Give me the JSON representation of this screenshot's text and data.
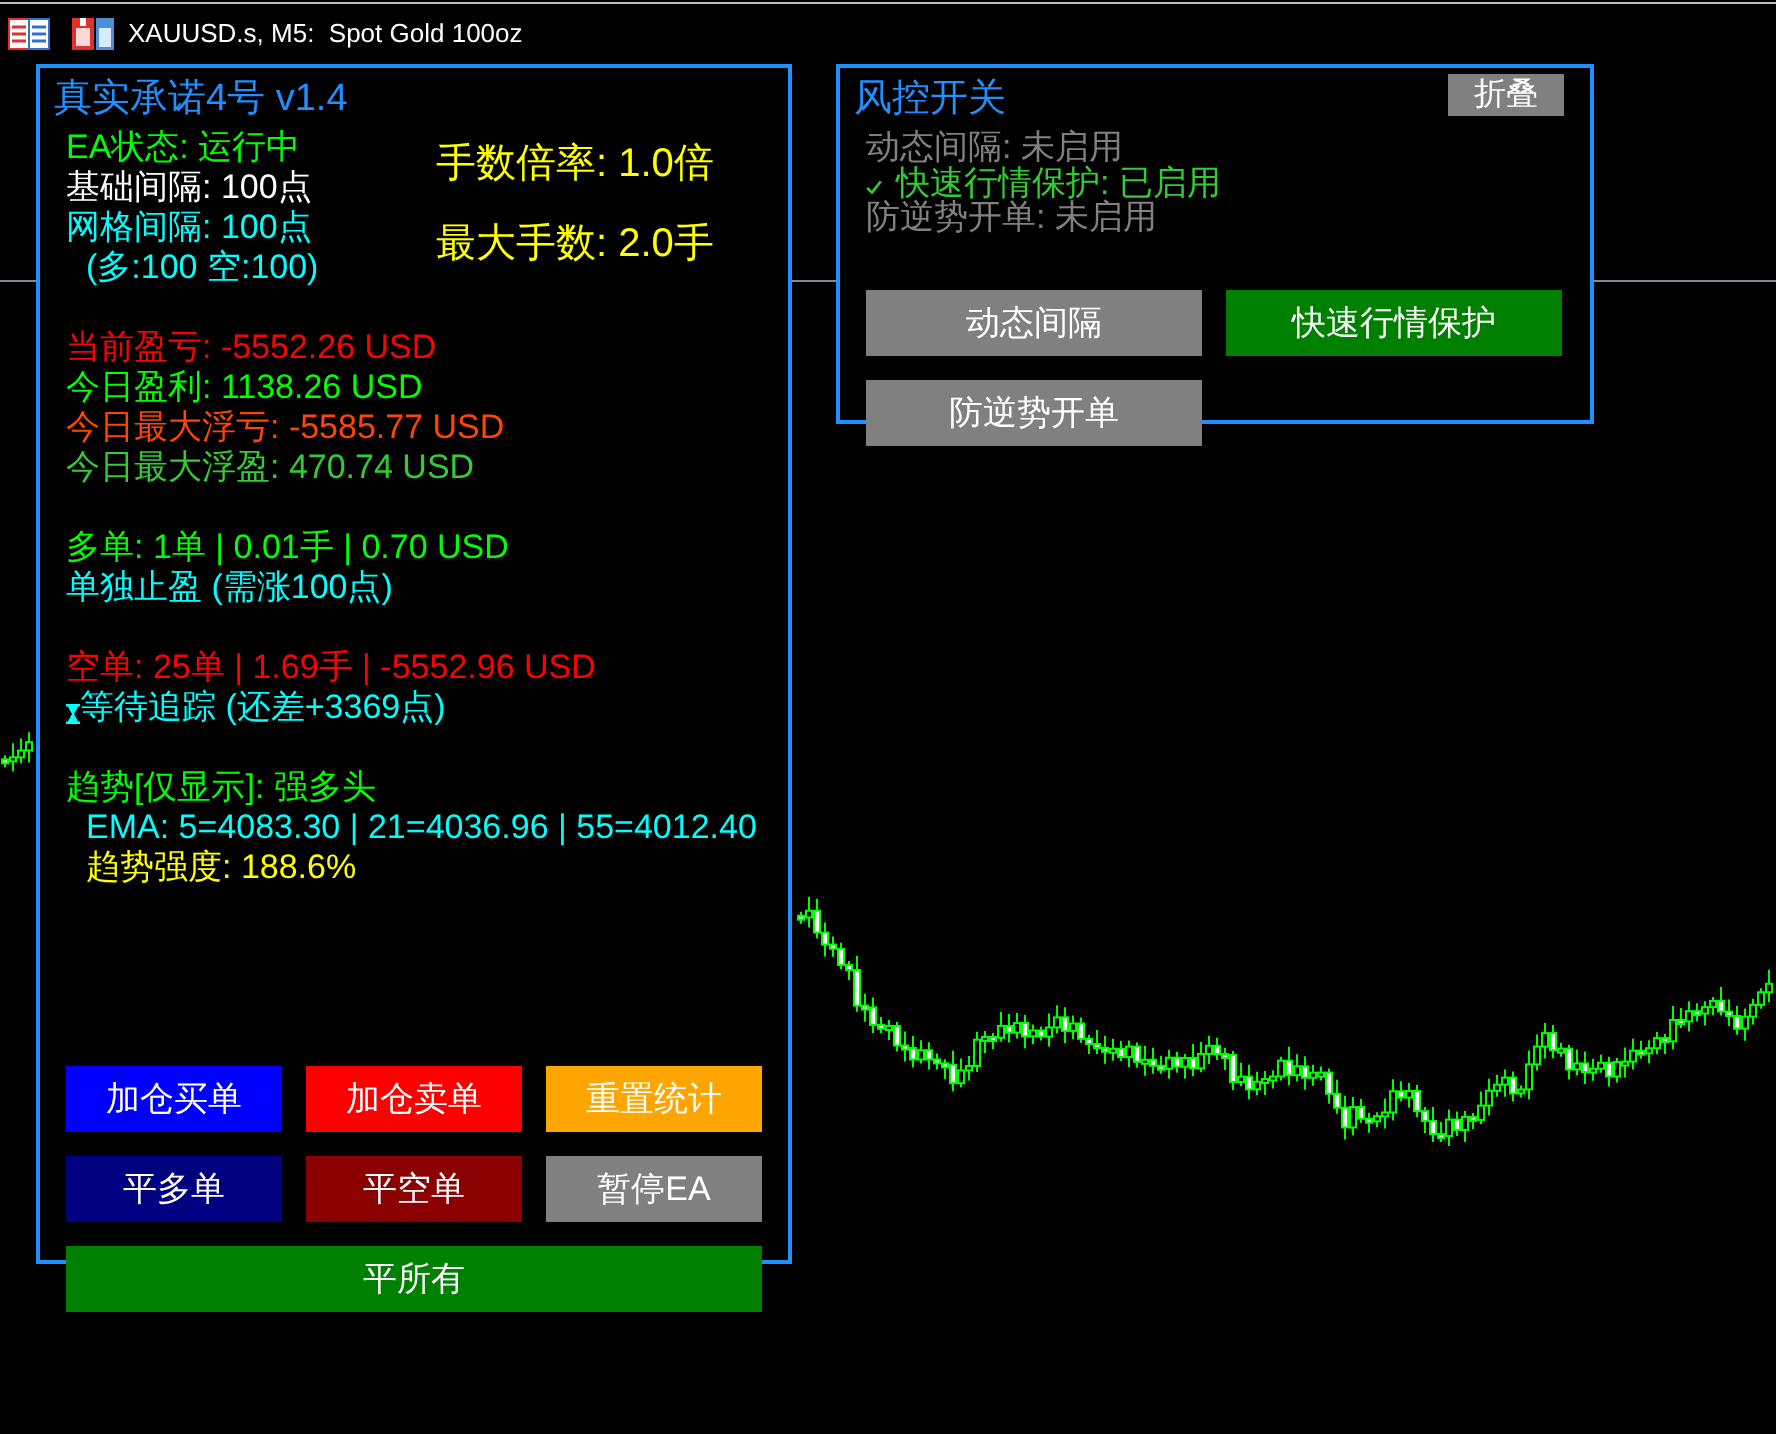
{
  "window": {
    "title": "XAUUSD.s, M5:  Spot Gold 100oz"
  },
  "main_panel": {
    "title": "真实承诺4号 v1.4",
    "lot_settings": [
      {
        "text": "手数倍率: 1.0倍"
      },
      {
        "text": "最大手数: 2.0手"
      }
    ],
    "groups": [
      {
        "lines": [
          {
            "kind": "text",
            "text": "EA状态: 运行中",
            "color": "#00ff00"
          },
          {
            "kind": "text",
            "text": "基础间隔: 100点",
            "color": "#ffffff"
          },
          {
            "kind": "text",
            "text": "网格间隔: 100点",
            "color": "#00ffff",
            "children": [
              {
                "kind": "text",
                "text": "(多:100 空:100)",
                "color": "#00ffff"
              }
            ]
          }
        ]
      },
      {
        "lines": [
          {
            "kind": "text",
            "text": "当前盈亏: -5552.26 USD",
            "color": "#ff0000"
          },
          {
            "kind": "text",
            "text": "今日盈利: 1138.26 USD",
            "color": "#00ff00"
          },
          {
            "kind": "text",
            "text": "今日最大浮亏: -5585.77 USD",
            "color": "#ff4500"
          },
          {
            "kind": "text",
            "text": "今日最大浮盈: 470.74 USD",
            "color": "#32cd32"
          }
        ]
      },
      {
        "lines": [
          {
            "kind": "text",
            "text": "多单: 1单 | 0.01手 | 0.70 USD",
            "color": "#00ff00"
          },
          {
            "kind": "text",
            "text": "单独止盈 (需涨100点)",
            "color": "#00ffff"
          }
        ]
      },
      {
        "lines": [
          {
            "kind": "text",
            "text": "空单: 25单 | 1.69手 | -5552.96 USD",
            "color": "#ff0000"
          },
          {
            "kind": "waiting",
            "text": "等待追踪 (还差+3369点)",
            "color": "#00ffff"
          }
        ]
      },
      {
        "lines": [
          {
            "kind": "text",
            "text": "趋势[仅显示]: 强多头",
            "color": "#00ff00",
            "children": [
              {
                "kind": "text",
                "text": "EMA: 5=4083.30 | 21=4036.96 | 55=4012.40",
                "color": "#00ffff"
              },
              {
                "kind": "text",
                "text": "趋势强度: 188.6%",
                "color": "#ffff00"
              }
            ]
          }
        ]
      }
    ],
    "button_rows": [
      {
        "buttons": [
          {
            "label": "加仓买单",
            "color": "#0000ff"
          },
          {
            "label": "加仓卖单",
            "color": "#ff0000"
          },
          {
            "label": "重置统计",
            "color": "#ffa500"
          }
        ]
      },
      {
        "buttons": [
          {
            "label": "平多单",
            "color": "#000080"
          },
          {
            "label": "平空单",
            "color": "#8b0000"
          },
          {
            "label": "暂停EA",
            "color": "#808080"
          }
        ]
      },
      {
        "buttons": [
          {
            "label": "平所有",
            "color": "#008000"
          }
        ]
      }
    ]
  },
  "risk_panel": {
    "title": "风控开关",
    "collapse_button": "折叠",
    "toggles": [
      {
        "text": "动态间隔: 未启用",
        "on": false
      },
      {
        "text": "快速行情保护: 已启用",
        "on": true
      },
      {
        "text": "防逆势开单: 未启用",
        "on": false
      }
    ],
    "buttons": [
      {
        "label": "动态间隔",
        "on": false
      },
      {
        "label": "快速行情保护",
        "on": true
      },
      {
        "label": "防逆势开单",
        "on": false
      }
    ]
  }
}
